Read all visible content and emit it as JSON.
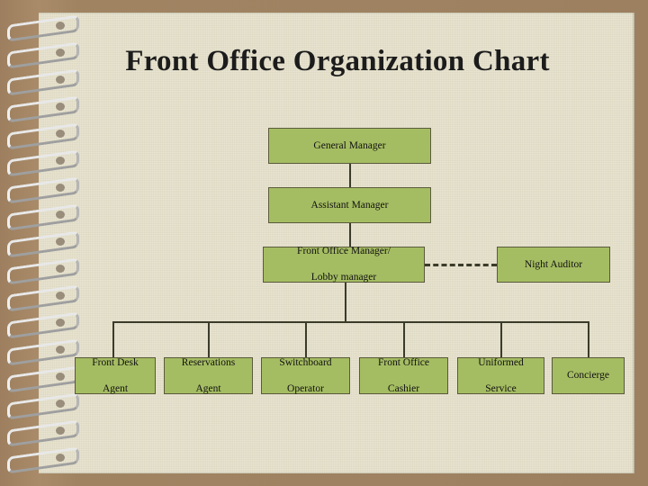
{
  "slide": {
    "title": "Front Office Organization Chart"
  },
  "chart_data": {
    "type": "diagram",
    "title": "Front Office Organization Chart",
    "nodes": [
      {
        "id": "general-manager",
        "label": "General Manager",
        "level": 0
      },
      {
        "id": "assistant-manager",
        "label": "Assistant Manager",
        "level": 1
      },
      {
        "id": "front-office-manager",
        "label_line1": "Front Office Manager/",
        "label_line2": "Lobby manager",
        "level": 2
      },
      {
        "id": "night-auditor",
        "label": "Night Auditor",
        "level": 2
      },
      {
        "id": "front-desk-agent",
        "label_line1": "Front Desk",
        "label_line2": "Agent",
        "level": 3
      },
      {
        "id": "reservations-agent",
        "label_line1": "Reservations",
        "label_line2": "Agent",
        "level": 3
      },
      {
        "id": "switchboard-operator",
        "label_line1": "Switchboard",
        "label_line2": "Operator",
        "level": 3
      },
      {
        "id": "front-office-cashier",
        "label_line1": "Front Office",
        "label_line2": "Cashier",
        "level": 3
      },
      {
        "id": "uniformed-service",
        "label_line1": "Uniformed",
        "label_line2": "Service",
        "level": 3
      },
      {
        "id": "concierge",
        "label": "Concierge",
        "level": 3
      }
    ],
    "edges": [
      {
        "from": "general-manager",
        "to": "assistant-manager",
        "style": "solid"
      },
      {
        "from": "assistant-manager",
        "to": "front-office-manager",
        "style": "solid"
      },
      {
        "from": "front-office-manager",
        "to": "night-auditor",
        "style": "dashed"
      },
      {
        "from": "front-office-manager",
        "to": "front-desk-agent",
        "style": "solid"
      },
      {
        "from": "front-office-manager",
        "to": "reservations-agent",
        "style": "solid"
      },
      {
        "from": "front-office-manager",
        "to": "switchboard-operator",
        "style": "solid"
      },
      {
        "from": "front-office-manager",
        "to": "front-office-cashier",
        "style": "solid"
      },
      {
        "from": "front-office-manager",
        "to": "uniformed-service",
        "style": "solid"
      },
      {
        "from": "front-office-manager",
        "to": "concierge",
        "style": "solid"
      }
    ],
    "colors": {
      "node_fill": "#a5bd62",
      "node_border": "#5a5a3c",
      "line": "#3b3b2a",
      "page": "#e4dfc8",
      "cover": "#a08462"
    }
  }
}
